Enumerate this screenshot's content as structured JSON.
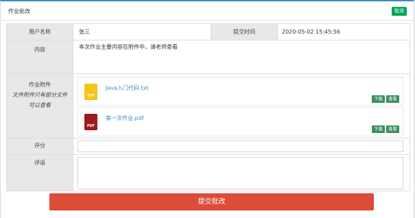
{
  "header": {
    "title": "作业批改",
    "cancel_label": "取消"
  },
  "form": {
    "username_label": "用户名称",
    "username_value": "张三",
    "submit_time_label": "提交时间",
    "submit_time_value": "2020-05-02 15:45:56",
    "content_label": "内容",
    "content_value": "本次作业主要内容在附件中，请老师查看",
    "attachments_label": "作业附件",
    "attachments_hint": "文件附件只有部分文件可以查看",
    "attachments": [
      {
        "ext": "TXT",
        "name": "Java入门代码.txt",
        "download_label": "下载",
        "view_label": "查看"
      },
      {
        "ext": "PDF",
        "name": "第一次作业.pdf",
        "download_label": "下载",
        "view_label": "查看"
      }
    ],
    "score_label": "评分",
    "score_value": "",
    "comment_label": "评语",
    "comment_value": ""
  },
  "submit_label": "提交批改",
  "colors": {
    "accent": "#3c8dbc",
    "cancel_button": "#00a65a",
    "attachment_button": "#3a8e5f",
    "submit_button": "#dd4b39",
    "txt_icon": "#f6c51c",
    "pdf_icon": "#9b1c1c"
  },
  "icons": {
    "txt": "txt-file-icon",
    "pdf": "pdf-file-icon"
  }
}
